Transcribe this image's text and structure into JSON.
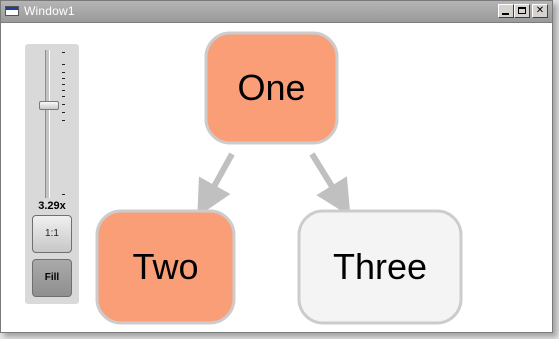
{
  "window": {
    "title": "Window1",
    "controls": {
      "minimize": "minimize",
      "maximize": "maximize",
      "close": "close"
    }
  },
  "zoom": {
    "label": "3.29x",
    "level": 0.56,
    "one_to_one_label": "1:1",
    "fill_label": "Fill"
  },
  "graph": {
    "nodes": [
      {
        "id": "one",
        "label": "One",
        "fill": "#fa9e78"
      },
      {
        "id": "two",
        "label": "Two",
        "fill": "#fa9e78"
      },
      {
        "id": "three",
        "label": "Three",
        "fill": "#f4f4f4"
      }
    ],
    "edges": [
      {
        "from": "one",
        "to": "two"
      },
      {
        "from": "one",
        "to": "three"
      }
    ],
    "border_color": "#cccccc",
    "edge_color": "#c0c0c0"
  }
}
